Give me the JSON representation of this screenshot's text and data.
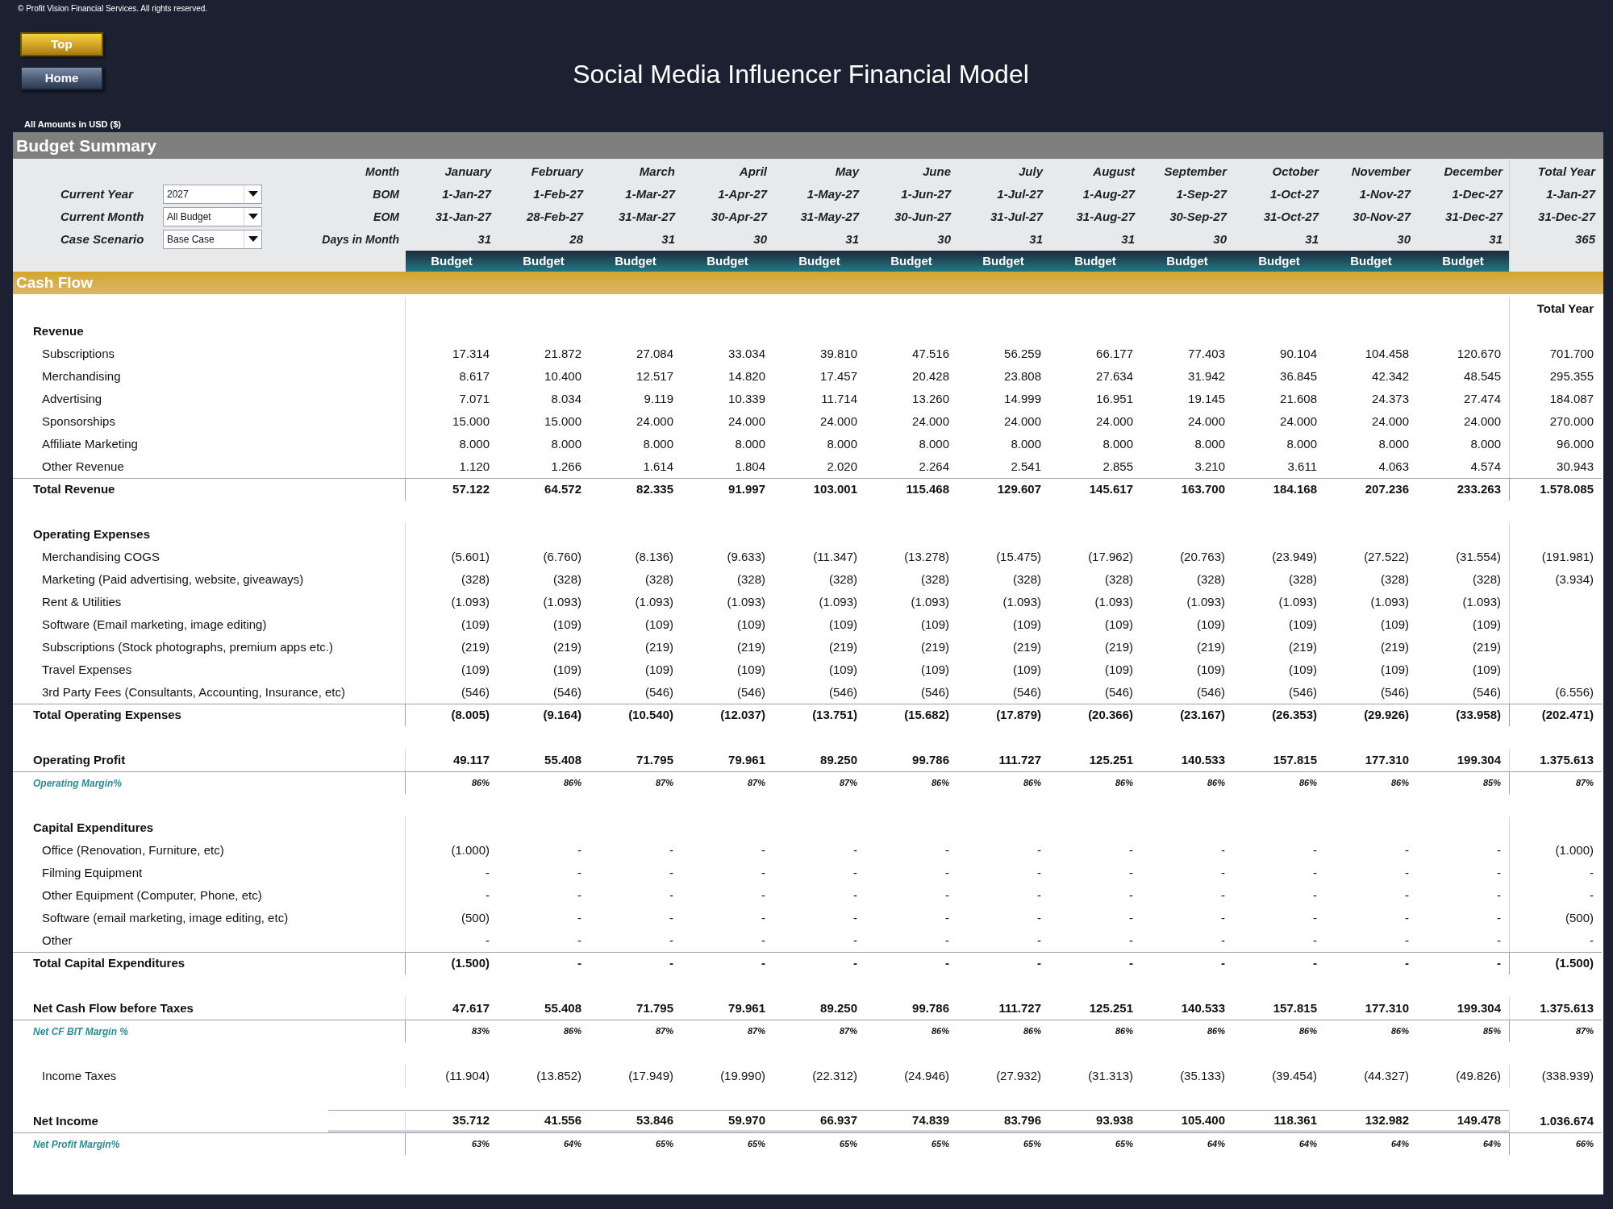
{
  "copyright": "© Profit Vision Financial Services. All rights reserved.",
  "nav_buttons": [
    {
      "label": "Top",
      "kind": "gold"
    },
    {
      "label": "Home",
      "kind": "steel"
    }
  ],
  "title": "Social Media Influencer Financial Model",
  "currency_note": "All Amounts in  USD ($)",
  "summary_title": "Budget Summary",
  "controls": [
    {
      "label": "Current Year",
      "value": "2027"
    },
    {
      "label": "Current Month",
      "value": "All Budget"
    },
    {
      "label": "Case Scenario",
      "value": "Base Case"
    }
  ],
  "header_labels": [
    "Month",
    "BOM",
    "EOM",
    "Days in Month"
  ],
  "months": [
    {
      "name": "January",
      "bom": "1-Jan-27",
      "eom": "31-Jan-27",
      "days": "31",
      "band": "Budget"
    },
    {
      "name": "February",
      "bom": "1-Feb-27",
      "eom": "28-Feb-27",
      "days": "28",
      "band": "Budget"
    },
    {
      "name": "March",
      "bom": "1-Mar-27",
      "eom": "31-Mar-27",
      "days": "31",
      "band": "Budget"
    },
    {
      "name": "April",
      "bom": "1-Apr-27",
      "eom": "30-Apr-27",
      "days": "30",
      "band": "Budget"
    },
    {
      "name": "May",
      "bom": "1-May-27",
      "eom": "31-May-27",
      "days": "31",
      "band": "Budget"
    },
    {
      "name": "June",
      "bom": "1-Jun-27",
      "eom": "30-Jun-27",
      "days": "30",
      "band": "Budget"
    },
    {
      "name": "July",
      "bom": "1-Jul-27",
      "eom": "31-Jul-27",
      "days": "31",
      "band": "Budget"
    },
    {
      "name": "August",
      "bom": "1-Aug-27",
      "eom": "31-Aug-27",
      "days": "31",
      "band": "Budget"
    },
    {
      "name": "September",
      "bom": "1-Sep-27",
      "eom": "30-Sep-27",
      "days": "30",
      "band": "Budget"
    },
    {
      "name": "October",
      "bom": "1-Oct-27",
      "eom": "31-Oct-27",
      "days": "31",
      "band": "Budget"
    },
    {
      "name": "November",
      "bom": "1-Nov-27",
      "eom": "30-Nov-27",
      "days": "30",
      "band": "Budget"
    },
    {
      "name": "December",
      "bom": "1-Dec-27",
      "eom": "31-Dec-27",
      "days": "31",
      "band": "Budget"
    }
  ],
  "total_column": {
    "name": "Total Year",
    "bom": "1-Jan-27",
    "eom": "31-Dec-27",
    "days": "365"
  },
  "cash_flow_title": "Cash Flow",
  "table_total_header": "Total Year",
  "rows": [
    {
      "kind": "section",
      "label": "Revenue"
    },
    {
      "kind": "item",
      "label": "Subscriptions",
      "values": [
        "17.314",
        "21.872",
        "27.084",
        "33.034",
        "39.810",
        "47.516",
        "56.259",
        "66.177",
        "77.403",
        "90.104",
        "104.458",
        "120.670"
      ],
      "total": "701.700"
    },
    {
      "kind": "item",
      "label": "Merchandising",
      "values": [
        "8.617",
        "10.400",
        "12.517",
        "14.820",
        "17.457",
        "20.428",
        "23.808",
        "27.634",
        "31.942",
        "36.845",
        "42.342",
        "48.545"
      ],
      "total": "295.355"
    },
    {
      "kind": "item",
      "label": "Advertising",
      "values": [
        "7.071",
        "8.034",
        "9.119",
        "10.339",
        "11.714",
        "13.260",
        "14.999",
        "16.951",
        "19.145",
        "21.608",
        "24.373",
        "27.474"
      ],
      "total": "184.087"
    },
    {
      "kind": "item",
      "label": "Sponsorships",
      "values": [
        "15.000",
        "15.000",
        "24.000",
        "24.000",
        "24.000",
        "24.000",
        "24.000",
        "24.000",
        "24.000",
        "24.000",
        "24.000",
        "24.000"
      ],
      "total": "270.000"
    },
    {
      "kind": "item",
      "label": "Affiliate Marketing",
      "values": [
        "8.000",
        "8.000",
        "8.000",
        "8.000",
        "8.000",
        "8.000",
        "8.000",
        "8.000",
        "8.000",
        "8.000",
        "8.000",
        "8.000"
      ],
      "total": "96.000"
    },
    {
      "kind": "item",
      "label": "Other Revenue",
      "values": [
        "1.120",
        "1.266",
        "1.614",
        "1.804",
        "2.020",
        "2.264",
        "2.541",
        "2.855",
        "3.210",
        "3.611",
        "4.063",
        "4.574"
      ],
      "total": "30.943"
    },
    {
      "kind": "total",
      "label": "Total Revenue",
      "values": [
        "57.122",
        "64.572",
        "82.335",
        "91.997",
        "103.001",
        "115.468",
        "129.607",
        "145.617",
        "163.700",
        "184.168",
        "207.236",
        "233.263"
      ],
      "total": "1.578.085"
    },
    {
      "kind": "blank"
    },
    {
      "kind": "section",
      "label": "Operating Expenses"
    },
    {
      "kind": "item",
      "label": "Merchandising COGS",
      "values": [
        "(5.601)",
        "(6.760)",
        "(8.136)",
        "(9.633)",
        "(11.347)",
        "(13.278)",
        "(15.475)",
        "(17.962)",
        "(20.763)",
        "(23.949)",
        "(27.522)",
        "(31.554)"
      ],
      "total": "(191.981)"
    },
    {
      "kind": "item",
      "label": "Marketing (Paid advertising, website, giveaways)",
      "values": [
        "(328)",
        "(328)",
        "(328)",
        "(328)",
        "(328)",
        "(328)",
        "(328)",
        "(328)",
        "(328)",
        "(328)",
        "(328)",
        "(328)"
      ],
      "total": "(3.934)"
    },
    {
      "kind": "item",
      "label": "Rent & Utilities",
      "values": [
        "(1.093)",
        "(1.093)",
        "(1.093)",
        "(1.093)",
        "(1.093)",
        "(1.093)",
        "(1.093)",
        "(1.093)",
        "(1.093)",
        "(1.093)",
        "(1.093)",
        "(1.093)"
      ]
    },
    {
      "kind": "item",
      "label": "Software (Email marketing, image editing)",
      "values": [
        "(109)",
        "(109)",
        "(109)",
        "(109)",
        "(109)",
        "(109)",
        "(109)",
        "(109)",
        "(109)",
        "(109)",
        "(109)",
        "(109)"
      ]
    },
    {
      "kind": "item",
      "label": "Subscriptions (Stock photographs, premium apps etc.)",
      "values": [
        "(219)",
        "(219)",
        "(219)",
        "(219)",
        "(219)",
        "(219)",
        "(219)",
        "(219)",
        "(219)",
        "(219)",
        "(219)",
        "(219)"
      ]
    },
    {
      "kind": "item",
      "label": "Travel Expenses",
      "values": [
        "(109)",
        "(109)",
        "(109)",
        "(109)",
        "(109)",
        "(109)",
        "(109)",
        "(109)",
        "(109)",
        "(109)",
        "(109)",
        "(109)"
      ]
    },
    {
      "kind": "item",
      "label": "3rd Party Fees (Consultants, Accounting, Insurance, etc)",
      "values": [
        "(546)",
        "(546)",
        "(546)",
        "(546)",
        "(546)",
        "(546)",
        "(546)",
        "(546)",
        "(546)",
        "(546)",
        "(546)",
        "(546)"
      ],
      "total": "(6.556)"
    },
    {
      "kind": "total",
      "label": "Total Operating Expenses",
      "values": [
        "(8.005)",
        "(9.164)",
        "(10.540)",
        "(12.037)",
        "(13.751)",
        "(15.682)",
        "(17.879)",
        "(20.366)",
        "(23.167)",
        "(26.353)",
        "(29.926)",
        "(33.958)"
      ],
      "total": "(202.471)"
    },
    {
      "kind": "blank"
    },
    {
      "kind": "subtotal",
      "label": "Operating Profit",
      "values": [
        "49.117",
        "55.408",
        "71.795",
        "79.961",
        "89.250",
        "99.786",
        "111.727",
        "125.251",
        "140.533",
        "157.815",
        "177.310",
        "199.304"
      ],
      "total": "1.375.613"
    },
    {
      "kind": "margin",
      "label": "Operating Margin%",
      "values": [
        "86%",
        "86%",
        "87%",
        "87%",
        "87%",
        "86%",
        "86%",
        "86%",
        "86%",
        "86%",
        "86%",
        "85%"
      ],
      "total": "87%"
    },
    {
      "kind": "blank"
    },
    {
      "kind": "section",
      "label": "Capital Expenditures"
    },
    {
      "kind": "item",
      "label": "Office (Renovation, Furniture, etc)",
      "values": [
        "(1.000)",
        "-",
        "-",
        "-",
        "-",
        "-",
        "-",
        "-",
        "-",
        "-",
        "-",
        "-"
      ],
      "total": "(1.000)"
    },
    {
      "kind": "item",
      "label": "Filming Equipment",
      "values": [
        "-",
        "-",
        "-",
        "-",
        "-",
        "-",
        "-",
        "-",
        "-",
        "-",
        "-",
        "-"
      ],
      "total": "-"
    },
    {
      "kind": "item",
      "label": "Other Equipment (Computer, Phone, etc)",
      "values": [
        "-",
        "-",
        "-",
        "-",
        "-",
        "-",
        "-",
        "-",
        "-",
        "-",
        "-",
        "-"
      ],
      "total": "-"
    },
    {
      "kind": "item",
      "label": "Software (email marketing, image editing, etc)",
      "values": [
        "(500)",
        "-",
        "-",
        "-",
        "-",
        "-",
        "-",
        "-",
        "-",
        "-",
        "-",
        "-"
      ],
      "total": "(500)"
    },
    {
      "kind": "item",
      "label": "Other",
      "values": [
        "-",
        "-",
        "-",
        "-",
        "-",
        "-",
        "-",
        "-",
        "-",
        "-",
        "-",
        "-"
      ],
      "total": "-"
    },
    {
      "kind": "total",
      "label": "Total Capital Expenditures",
      "values": [
        "(1.500)",
        "-",
        "-",
        "-",
        "-",
        "-",
        "-",
        "-",
        "-",
        "-",
        "-",
        "-"
      ],
      "total": "(1.500)"
    },
    {
      "kind": "blank"
    },
    {
      "kind": "subtotal",
      "label": "Net Cash Flow before Taxes",
      "values": [
        "47.617",
        "55.408",
        "71.795",
        "79.961",
        "89.250",
        "99.786",
        "111.727",
        "125.251",
        "140.533",
        "157.815",
        "177.310",
        "199.304"
      ],
      "total": "1.375.613"
    },
    {
      "kind": "margin",
      "label": "Net CF BIT Margin %",
      "values": [
        "83%",
        "86%",
        "87%",
        "87%",
        "87%",
        "86%",
        "86%",
        "86%",
        "86%",
        "86%",
        "86%",
        "85%"
      ],
      "total": "87%"
    },
    {
      "kind": "blank"
    },
    {
      "kind": "item",
      "label": "Income Taxes",
      "values": [
        "(11.904)",
        "(13.852)",
        "(17.949)",
        "(19.990)",
        "(22.312)",
        "(24.946)",
        "(27.932)",
        "(31.313)",
        "(35.133)",
        "(39.454)",
        "(44.327)",
        "(49.826)"
      ],
      "total": "(338.939)"
    },
    {
      "kind": "blank"
    },
    {
      "kind": "net",
      "label": "Net Income",
      "values": [
        "35.712",
        "41.556",
        "53.846",
        "59.970",
        "66.937",
        "74.839",
        "83.796",
        "93.938",
        "105.400",
        "118.361",
        "132.982",
        "149.478"
      ],
      "total": "1.036.674"
    },
    {
      "kind": "margin",
      "label": "Net Profit Margin%",
      "values": [
        "63%",
        "64%",
        "65%",
        "65%",
        "65%",
        "65%",
        "65%",
        "65%",
        "64%",
        "64%",
        "64%",
        "64%"
      ],
      "total": "66%"
    }
  ]
}
